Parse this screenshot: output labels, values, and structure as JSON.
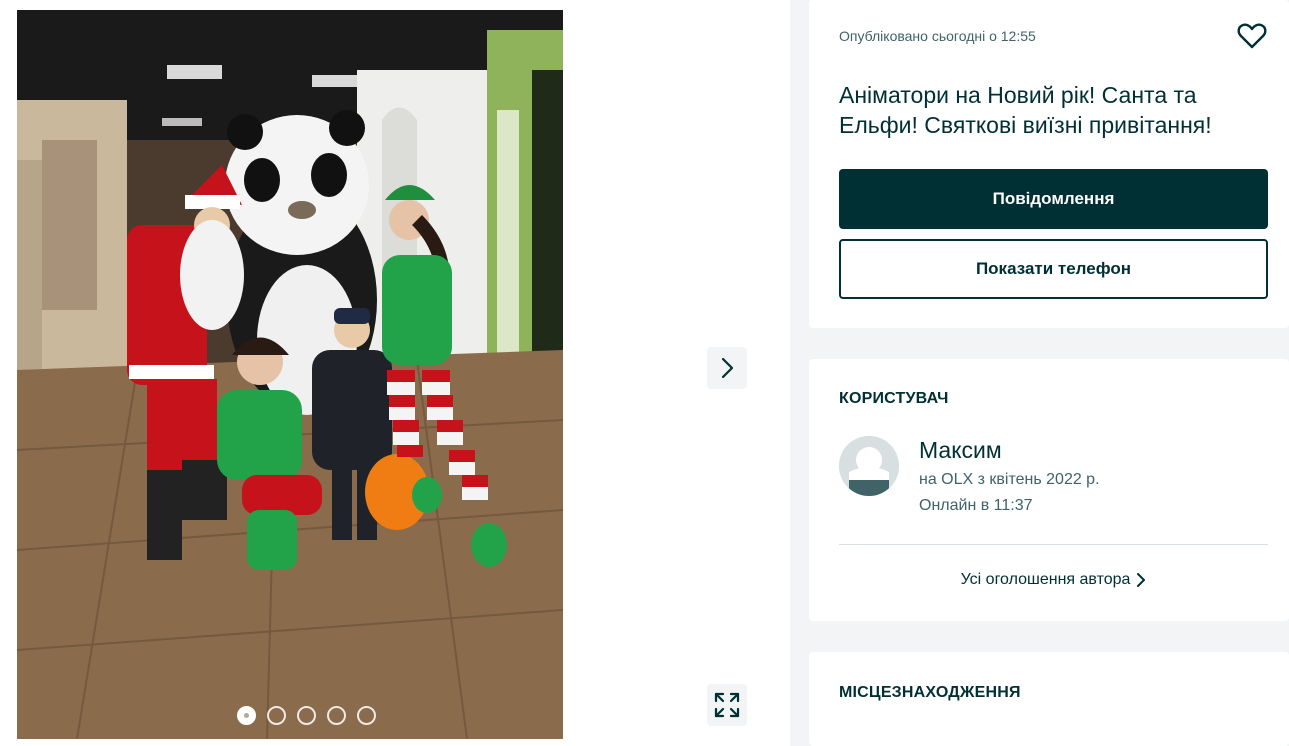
{
  "gallery": {
    "photo_alt": "Аніматори Санта, панда та ельфи з дитиною",
    "dots_count": 5,
    "active_dot": 0
  },
  "listing": {
    "published": "Опубліковано сьогодні о 12:55",
    "title": "Аніматори на Новий рік! Санта та Ельфи! Святкові виїзні привітання!",
    "message_button": "Повідомлення",
    "phone_button": "Показати телефон"
  },
  "user": {
    "section_title": "КОРИСТУВАЧ",
    "name": "Максим",
    "since": "на OLX з квітень 2022 р.",
    "online": "Онлайн в 11:37",
    "all_ads_link": "Усі оголошення автора"
  },
  "location": {
    "section_title": "МІСЦЕЗНАХОДЖЕННЯ"
  },
  "colors": {
    "brand_dark": "#002f34",
    "muted_text": "#406367",
    "panel_bg": "#f2f4f5"
  }
}
